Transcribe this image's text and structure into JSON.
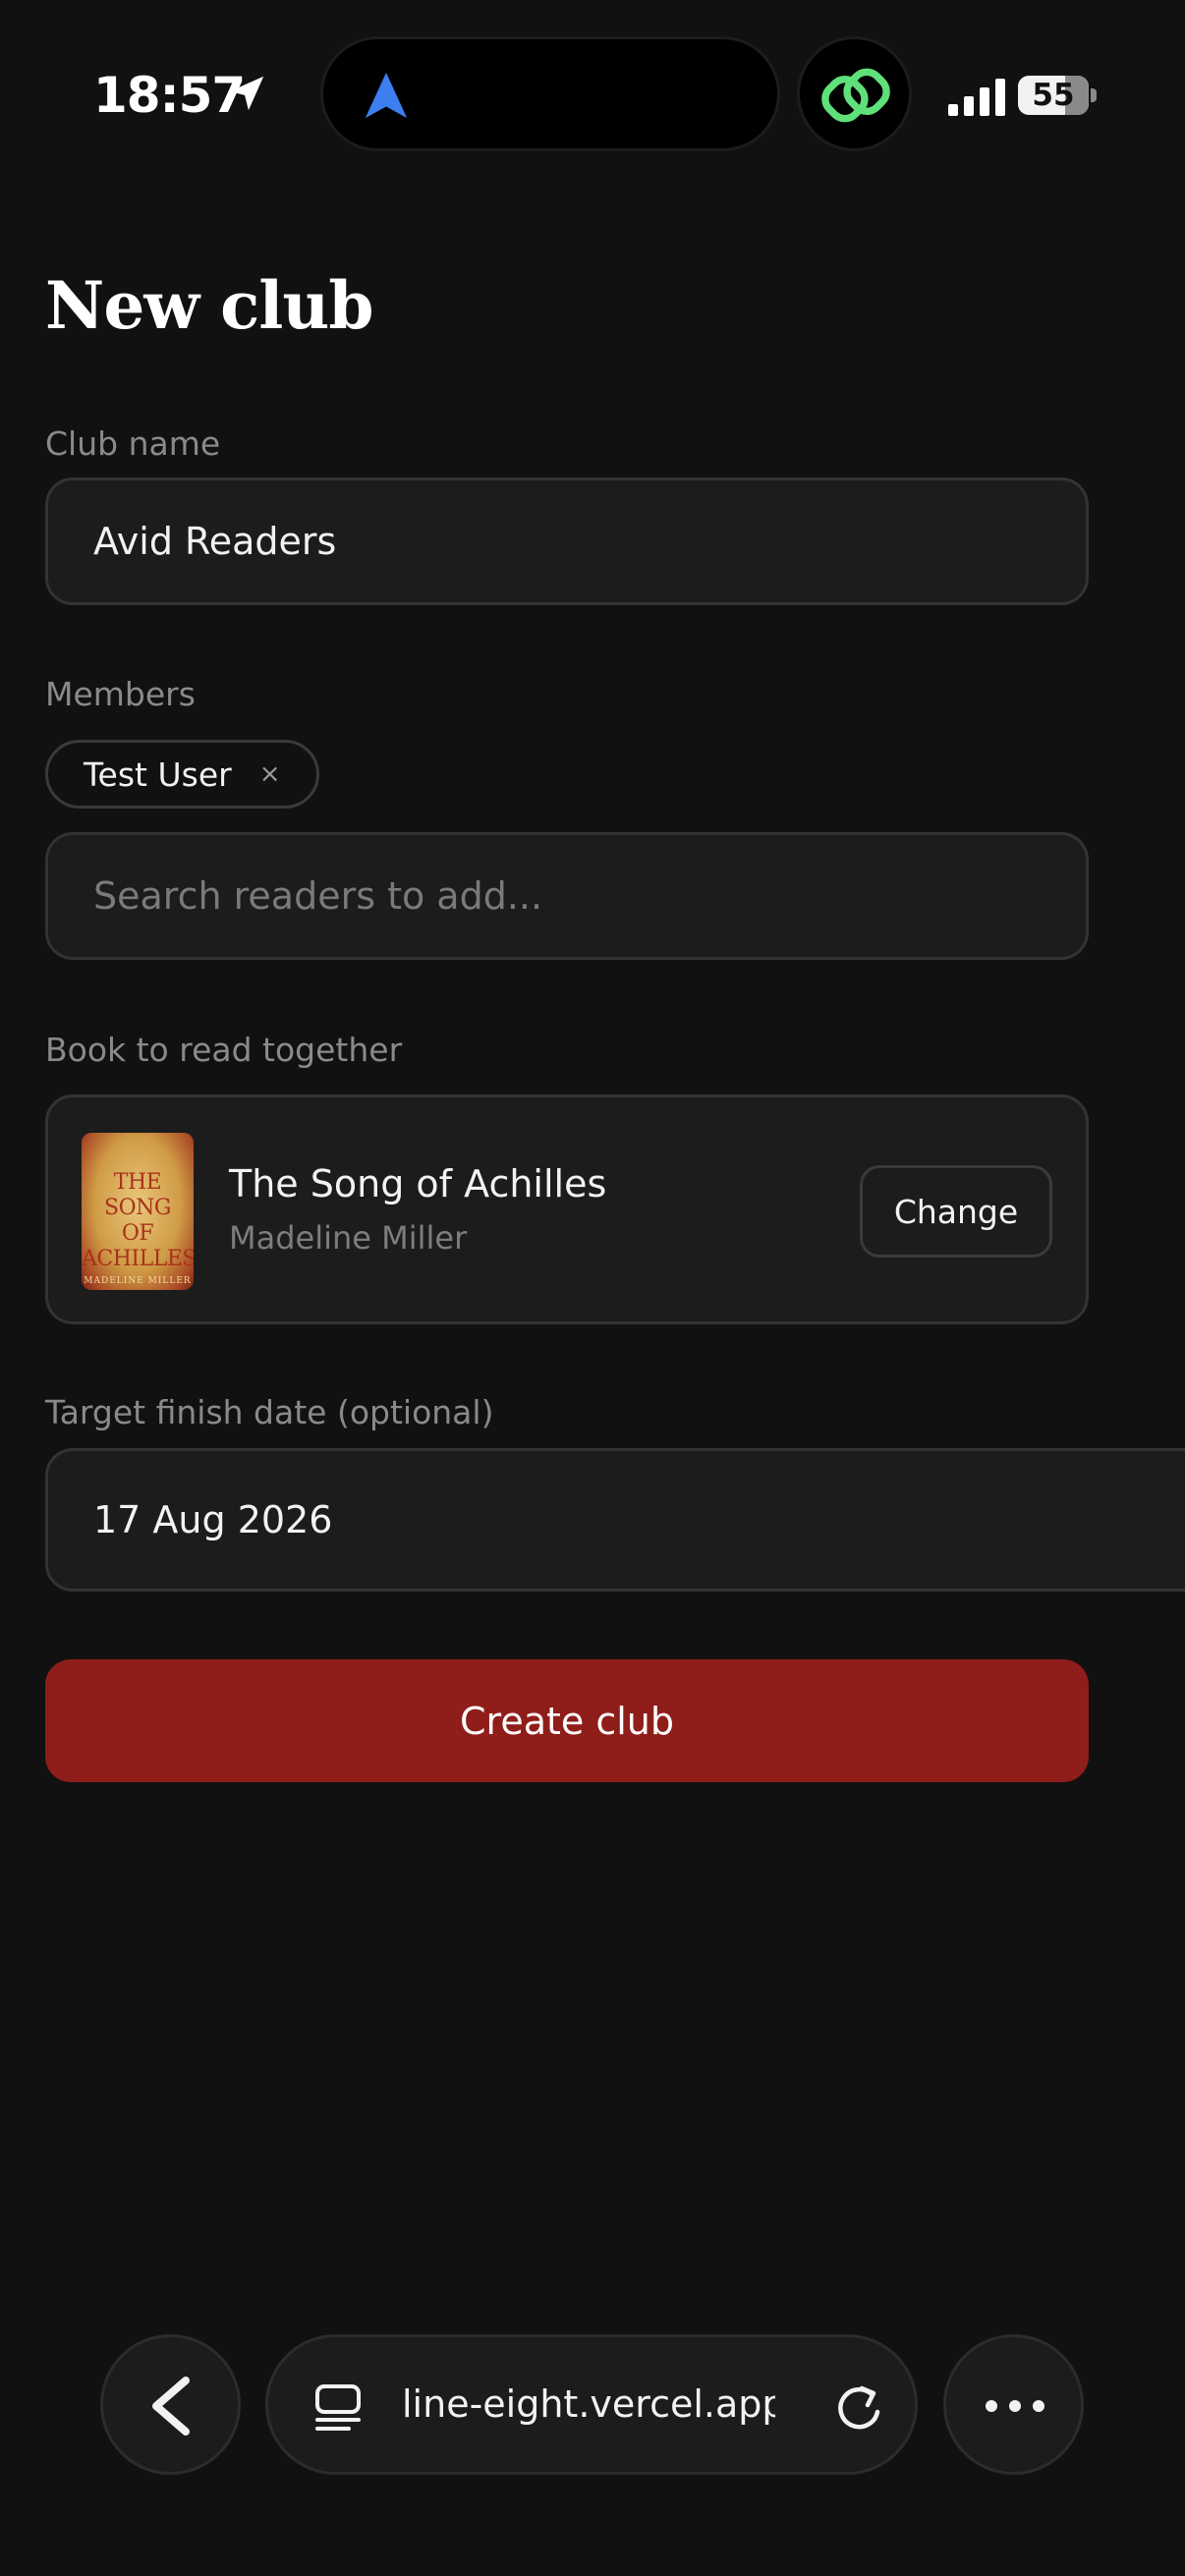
{
  "status_bar": {
    "time": "18:57",
    "battery": "55"
  },
  "form": {
    "title": "New club",
    "club_name_label": "Club name",
    "club_name_value": "Avid Readers",
    "members_label": "Members",
    "members": [
      {
        "name": "Test User",
        "remove": "×"
      }
    ],
    "search_placeholder": "Search readers to add...",
    "book_label": "Book to read together",
    "book": {
      "title": "The Song of Achilles",
      "author": "Madeline Miller",
      "cover_lines": [
        "THE",
        "SONG",
        "OF",
        "ACHILLES"
      ],
      "cover_author": "MADELINE MILLER",
      "change_label": "Change"
    },
    "date_label": "Target finish date (optional)",
    "date_value": "17 Aug 2026",
    "submit_label": "Create club"
  },
  "browser": {
    "url": "line-eight.vercel.app"
  },
  "colors": {
    "background": "#111111",
    "field": "#1c1c1c",
    "accent": "#8f1d1a",
    "muted_text": "#8a8a8a"
  }
}
